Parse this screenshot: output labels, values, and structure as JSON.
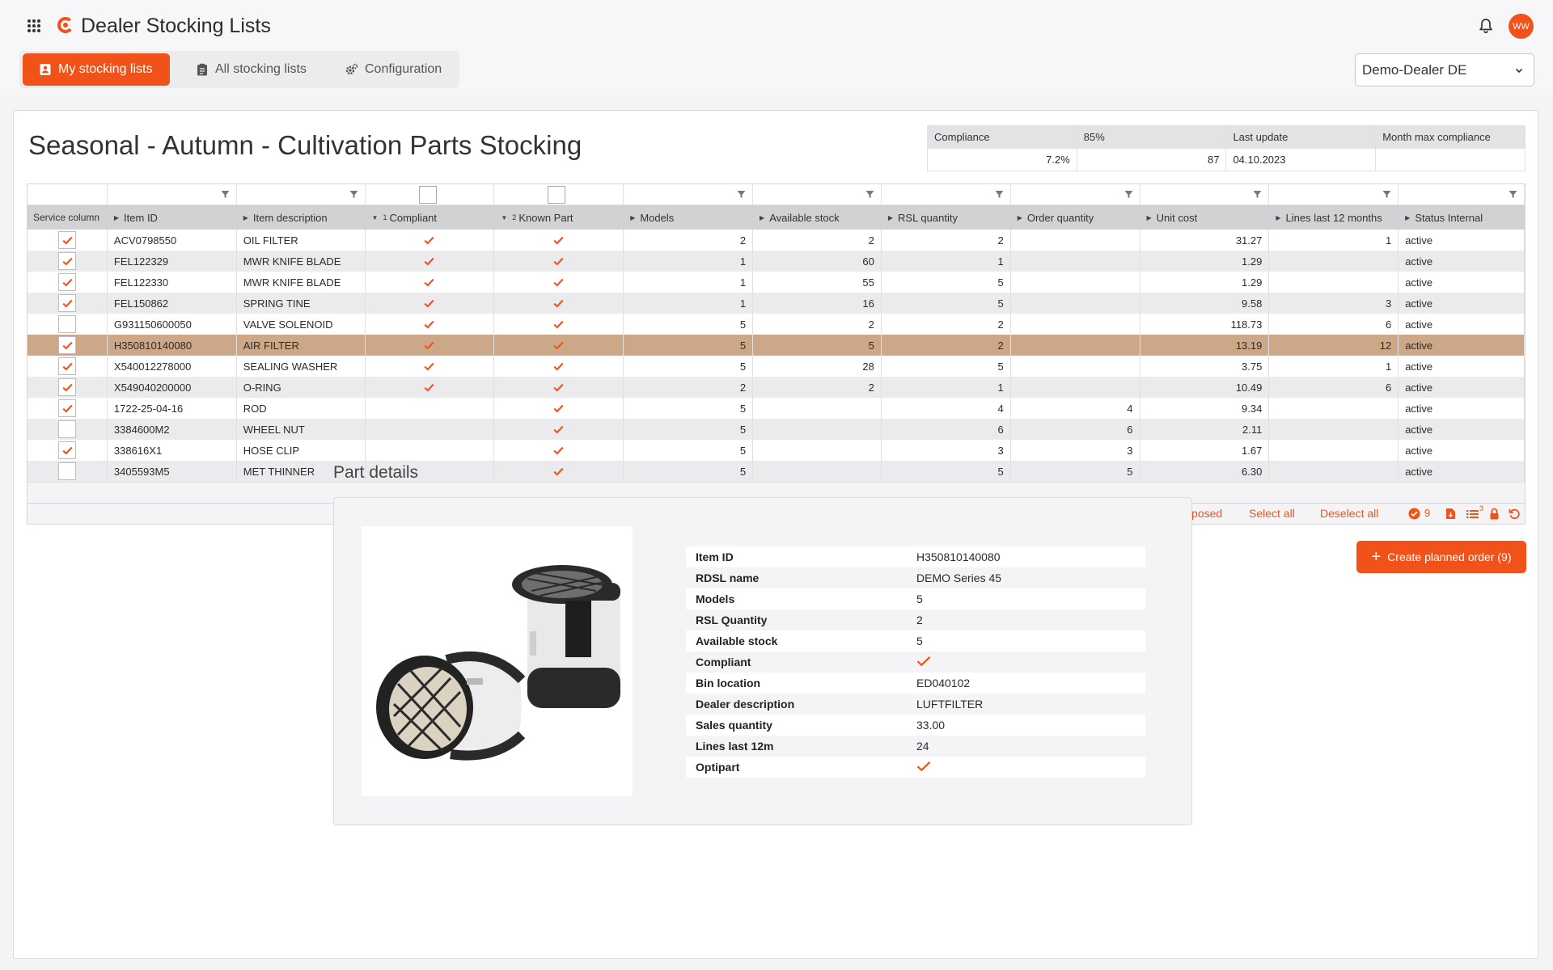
{
  "app": {
    "title": "Dealer Stocking Lists",
    "avatar_initials": "WW",
    "accent": "#f0521a"
  },
  "tabs": [
    {
      "label": "My stocking lists",
      "active": true
    },
    {
      "label": "All stocking lists",
      "active": false
    },
    {
      "label": "Configuration",
      "active": false
    }
  ],
  "dealer": {
    "selected": "Demo-Dealer DE"
  },
  "list": {
    "title": "Seasonal - Autumn - Cultivation Parts Stocking"
  },
  "kpi": {
    "headers": [
      "Compliance",
      "85%",
      "Last update",
      "Month max compliance"
    ],
    "values": [
      "7.2%",
      "87",
      "04.10.2023",
      ""
    ]
  },
  "grid": {
    "columns": [
      "Service column",
      "Item ID",
      "Item description",
      "Compliant",
      "Known Part",
      "Models",
      "Available stock",
      "RSL quantity",
      "Order quantity",
      "Unit cost",
      "Lines last 12 months",
      "Status Internal"
    ],
    "sort_index": {
      "compliant": "1",
      "known_part": "2"
    },
    "rows": [
      {
        "checked": true,
        "item_id": "ACV0798550",
        "desc": "OIL FILTER",
        "compliant": true,
        "known": true,
        "models": "2",
        "stock": "2",
        "rsl": "2",
        "order": "",
        "cost": "31.27",
        "lines": "1",
        "status": "active"
      },
      {
        "checked": true,
        "item_id": "FEL122329",
        "desc": "MWR KNIFE BLADE",
        "compliant": true,
        "known": true,
        "models": "1",
        "stock": "60",
        "rsl": "1",
        "order": "",
        "cost": "1.29",
        "lines": "",
        "status": "active"
      },
      {
        "checked": true,
        "item_id": "FEL122330",
        "desc": "MWR KNIFE BLADE",
        "compliant": true,
        "known": true,
        "models": "1",
        "stock": "55",
        "rsl": "5",
        "order": "",
        "cost": "1.29",
        "lines": "",
        "status": "active"
      },
      {
        "checked": true,
        "item_id": "FEL150862",
        "desc": "SPRING TINE",
        "compliant": true,
        "known": true,
        "models": "1",
        "stock": "16",
        "rsl": "5",
        "order": "",
        "cost": "9.58",
        "lines": "3",
        "status": "active"
      },
      {
        "checked": false,
        "item_id": "G931150600050",
        "desc": "VALVE SOLENOID",
        "compliant": true,
        "known": true,
        "models": "5",
        "stock": "2",
        "rsl": "2",
        "order": "",
        "cost": "118.73",
        "lines": "6",
        "status": "active"
      },
      {
        "checked": true,
        "item_id": "H350810140080",
        "desc": "AIR FILTER",
        "compliant": true,
        "known": true,
        "models": "5",
        "stock": "5",
        "rsl": "2",
        "order": "",
        "cost": "13.19",
        "lines": "12",
        "status": "active",
        "selected": true
      },
      {
        "checked": true,
        "item_id": "X540012278000",
        "desc": "SEALING WASHER",
        "compliant": true,
        "known": true,
        "models": "5",
        "stock": "28",
        "rsl": "5",
        "order": "",
        "cost": "3.75",
        "lines": "1",
        "status": "active"
      },
      {
        "checked": true,
        "item_id": "X549040200000",
        "desc": "O-RING",
        "compliant": true,
        "known": true,
        "models": "2",
        "stock": "2",
        "rsl": "1",
        "order": "",
        "cost": "10.49",
        "lines": "6",
        "status": "active"
      },
      {
        "checked": true,
        "item_id": "1722-25-04-16",
        "desc": "ROD",
        "compliant": false,
        "known": true,
        "models": "5",
        "stock": "",
        "rsl": "4",
        "order": "4",
        "cost": "9.34",
        "lines": "",
        "status": "active"
      },
      {
        "checked": false,
        "item_id": "3384600M2",
        "desc": "WHEEL NUT",
        "compliant": false,
        "known": true,
        "models": "5",
        "stock": "",
        "rsl": "6",
        "order": "6",
        "cost": "2.11",
        "lines": "",
        "status": "active"
      },
      {
        "checked": true,
        "item_id": "338616X1",
        "desc": "HOSE CLIP",
        "compliant": false,
        "known": true,
        "models": "5",
        "stock": "",
        "rsl": "3",
        "order": "3",
        "cost": "1.67",
        "lines": "",
        "status": "active"
      },
      {
        "checked": false,
        "item_id": "3405593M5",
        "desc": "MET THINNER",
        "compliant": false,
        "known": true,
        "models": "5",
        "stock": "",
        "rsl": "5",
        "order": "5",
        "cost": "6.30",
        "lines": "",
        "status": "active"
      }
    ]
  },
  "footer": {
    "select_proposed": "Select proposed",
    "select_all": "Select all",
    "deselect_all": "Deselect all",
    "checked_count": "9",
    "list_badge": "3"
  },
  "create_button": "Create planned order (9)",
  "part_details": {
    "title": "Part details",
    "fields": [
      {
        "label": "Item ID",
        "value": "H350810140080"
      },
      {
        "label": "RDSL name",
        "value": "DEMO Series 45"
      },
      {
        "label": "Models",
        "value": "5"
      },
      {
        "label": "RSL Quantity",
        "value": "2"
      },
      {
        "label": "Available stock",
        "value": "5"
      },
      {
        "label": "Compliant",
        "value": "",
        "check": true
      },
      {
        "label": "Bin location",
        "value": "ED040102"
      },
      {
        "label": "Dealer description",
        "value": "LUFTFILTER"
      },
      {
        "label": "Sales quantity",
        "value": "33.00"
      },
      {
        "label": "Lines last 12m",
        "value": "24"
      },
      {
        "label": "Optipart",
        "value": "",
        "check": true
      }
    ]
  }
}
